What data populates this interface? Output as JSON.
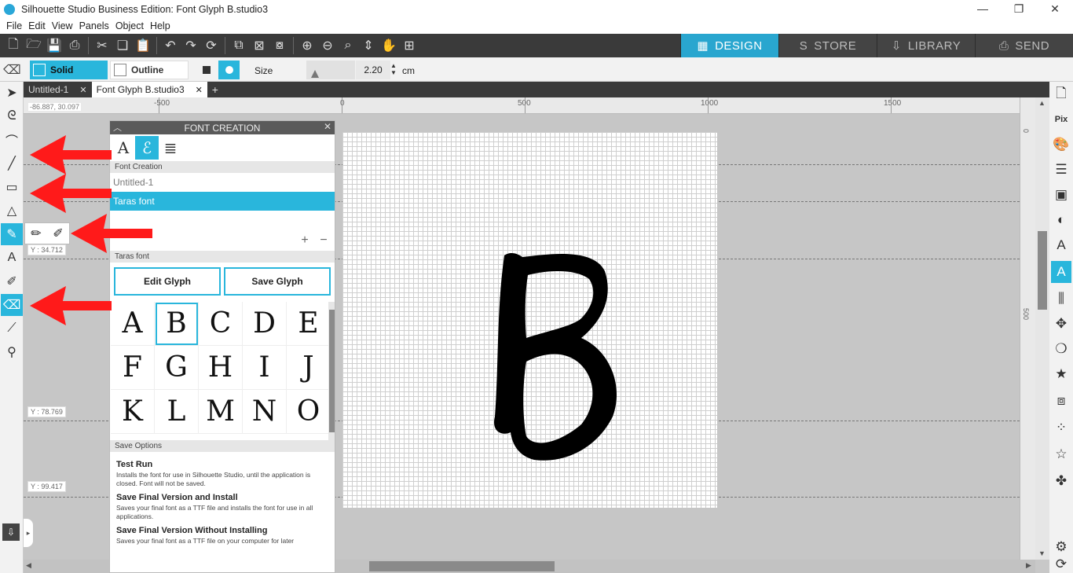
{
  "window": {
    "title": "Silhouette Studio Business Edition: Font Glyph B.studio3",
    "controls": [
      "—",
      "❐",
      "✕"
    ]
  },
  "menu": [
    "File",
    "Edit",
    "View",
    "Panels",
    "Object",
    "Help"
  ],
  "modes": [
    {
      "label": "DESIGN",
      "icon": "▦"
    },
    {
      "label": "STORE",
      "icon": "S"
    },
    {
      "label": "LIBRARY",
      "icon": "⇩"
    },
    {
      "label": "SEND",
      "icon": "⎙"
    }
  ],
  "options": {
    "solid_label": "Solid",
    "outline_label": "Outline",
    "size_label": "Size",
    "size_value": "2.20",
    "size_unit": "cm"
  },
  "doc_tabs": [
    {
      "label": "Untitled-1"
    },
    {
      "label": "Font Glyph B.studio3"
    }
  ],
  "ruler": {
    "top_labels": [
      "-500",
      "0",
      "500",
      "1000",
      "1500"
    ],
    "side_labels": [
      "0",
      "500"
    ],
    "coord_readout": "-86.887, 30.097"
  },
  "canvas": {
    "coord_labels": [
      "Y : 34.712",
      "Y : 78.769",
      "Y : 99.417"
    ],
    "glyph_letter": "B"
  },
  "font_panel": {
    "title": "FONT CREATION",
    "section_font_creation": "Font Creation",
    "fonts": [
      "Untitled-1",
      "Taras font"
    ],
    "selected_font_header": "Taras font",
    "edit_glyph_label": "Edit Glyph",
    "save_glyph_label": "Save Glyph",
    "glyphs": [
      "A",
      "B",
      "C",
      "D",
      "E",
      "F",
      "G",
      "H",
      "I",
      "J",
      "K",
      "L",
      "M",
      "N",
      "O"
    ],
    "selected_glyph": "B",
    "save_options_header": "Save Options",
    "save_options": [
      {
        "title": "Test Run",
        "desc": "Installs the font for use in Silhouette Studio, until the application is closed. Font will not be saved."
      },
      {
        "title": "Save Final Version and Install",
        "desc": "Saves your final font as a TTF file and installs the font for use in all applications."
      },
      {
        "title": "Save Final Version Without Installing",
        "desc": "Saves your final font as a TTF file on your computer for later"
      }
    ]
  },
  "colors": {
    "accent": "#29b6dc",
    "toolbar_bg": "#3a3a3a",
    "annotation_arrow": "#ff1a1a"
  }
}
